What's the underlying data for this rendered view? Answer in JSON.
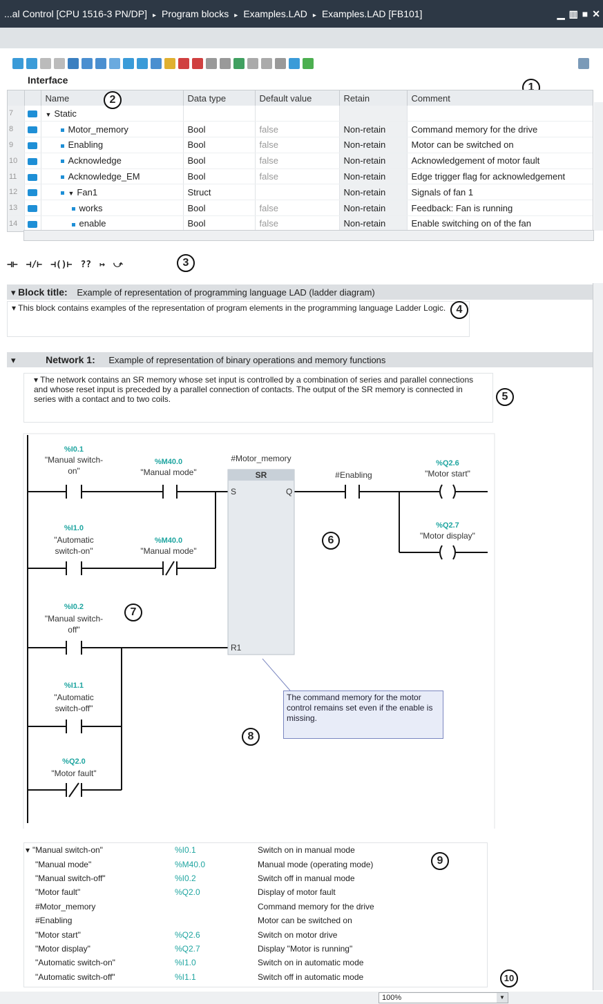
{
  "titlebar": {
    "path": [
      "...al Control [CPU 1516-3 PN/DP]",
      "Program blocks",
      "Examples.LAD",
      "Examples.LAD [FB101]"
    ],
    "sep": "▸"
  },
  "interface": {
    "title": "Interface",
    "columns": [
      "Name",
      "Data type",
      "Default value",
      "Retain",
      "Comment"
    ],
    "rows": [
      {
        "num": "7",
        "name": "Static",
        "type": "",
        "default": "",
        "retain": "",
        "comment": "",
        "indent": 0,
        "expand": true
      },
      {
        "num": "8",
        "name": "Motor_memory",
        "type": "Bool",
        "default": "false",
        "retain": "Non-retain",
        "comment": "Command memory for the drive",
        "indent": 1
      },
      {
        "num": "9",
        "name": "Enabling",
        "type": "Bool",
        "default": "false",
        "retain": "Non-retain",
        "comment": "Motor can be switched on",
        "indent": 1
      },
      {
        "num": "10",
        "name": "Acknowledge",
        "type": "Bool",
        "default": "false",
        "retain": "Non-retain",
        "comment": "Acknowledgement of motor fault",
        "indent": 1
      },
      {
        "num": "11",
        "name": "Acknowledge_EM",
        "type": "Bool",
        "default": "false",
        "retain": "Non-retain",
        "comment": "Edge trigger flag for acknowledgement",
        "indent": 1
      },
      {
        "num": "12",
        "name": "Fan1",
        "type": "Struct",
        "default": "",
        "retain": "Non-retain",
        "comment": "Signals of fan 1",
        "indent": 1,
        "expand": true
      },
      {
        "num": "13",
        "name": "works",
        "type": "Bool",
        "default": "false",
        "retain": "Non-retain",
        "comment": "Feedback: Fan is running",
        "indent": 2
      },
      {
        "num": "14",
        "name": "enable",
        "type": "Bool",
        "default": "false",
        "retain": "Non-retain",
        "comment": "Enable switching on of the fan",
        "indent": 2
      }
    ]
  },
  "lad_toolbar": [
    "⊣⊢",
    "⊣/⊢",
    "⊣()⊢",
    "??",
    "↦",
    "⤻"
  ],
  "block": {
    "label": "Block title:",
    "title": "Example of representation of programming language LAD (ladder diagram)",
    "comment": "This block contains examples of the representation of program elements in the programming language Ladder Logic."
  },
  "network": {
    "label": "Network 1:",
    "title": "Example of representation of binary operations and memory functions",
    "comment": "The network contains an SR memory whose set input is controlled by a combination of series and parallel connections and whose reset input is preceded by a parallel connection of contacts. The output of the SR memory is connected in series with a contact and to two coils."
  },
  "ladder": {
    "c1_addr": "%I0.1",
    "c1_name1": "\"Manual switch-",
    "c1_name2": "on\"",
    "c2_addr": "%M40.0",
    "c2_name": "\"Manual mode\"",
    "c3_addr": "%I1.0",
    "c3_name1": "\"Automatic",
    "c3_name2": "switch-on\"",
    "c4_addr": "%M40.0",
    "c4_name": "\"Manual mode\"",
    "c5_addr": "%I0.2",
    "c5_name1": "\"Manual switch-",
    "c5_name2": "off\"",
    "c6_addr": "%I1.1",
    "c6_name1": "\"Automatic",
    "c6_name2": "switch-off\"",
    "c7_addr": "%Q2.0",
    "c7_name": "\"Motor fault\"",
    "sr_var": "#Motor_memory",
    "sr_title": "SR",
    "sr_s": "S",
    "sr_q": "Q",
    "sr_r": "R1",
    "en_name": "#Enabling",
    "coil1_addr": "%Q2.6",
    "coil1_name": "\"Motor start\"",
    "coil2_addr": "%Q2.7",
    "coil2_name": "\"Motor display\""
  },
  "tooltip": "The command memory for the motor control remains set even if the enable is missing.",
  "symbols": [
    {
      "name": "\"Manual switch-on\"",
      "addr": "%I0.1",
      "comment": "Switch on in manual mode"
    },
    {
      "name": "\"Manual mode\"",
      "addr": "%M40.0",
      "comment": "Manual mode (operating mode)"
    },
    {
      "name": "\"Manual switch-off\"",
      "addr": "%I0.2",
      "comment": "Switch off in manual mode"
    },
    {
      "name": "\"Motor fault\"",
      "addr": "%Q2.0",
      "comment": "Display of motor fault"
    },
    {
      "name": "#Motor_memory",
      "addr": "",
      "comment": "Command memory for the drive"
    },
    {
      "name": "#Enabling",
      "addr": "",
      "comment": "Motor can be switched on"
    },
    {
      "name": "\"Motor start\"",
      "addr": "%Q2.6",
      "comment": "Switch on motor drive"
    },
    {
      "name": "\"Motor display\"",
      "addr": "%Q2.7",
      "comment": "Display \"Motor is running\""
    },
    {
      "name": "\"Automatic switch-on\"",
      "addr": "%I1.0",
      "comment": "Switch on in automatic mode"
    },
    {
      "name": "\"Automatic switch-off\"",
      "addr": "%I1.1",
      "comment": "Switch off in automatic mode"
    }
  ],
  "callouts": [
    "1",
    "2",
    "3",
    "4",
    "5",
    "6",
    "7",
    "8",
    "9",
    "10"
  ],
  "zoom": "100%",
  "colors": {
    "accent": "#1e8fd6",
    "address": "#1fa5a0",
    "titlebar": "#2d3845"
  }
}
